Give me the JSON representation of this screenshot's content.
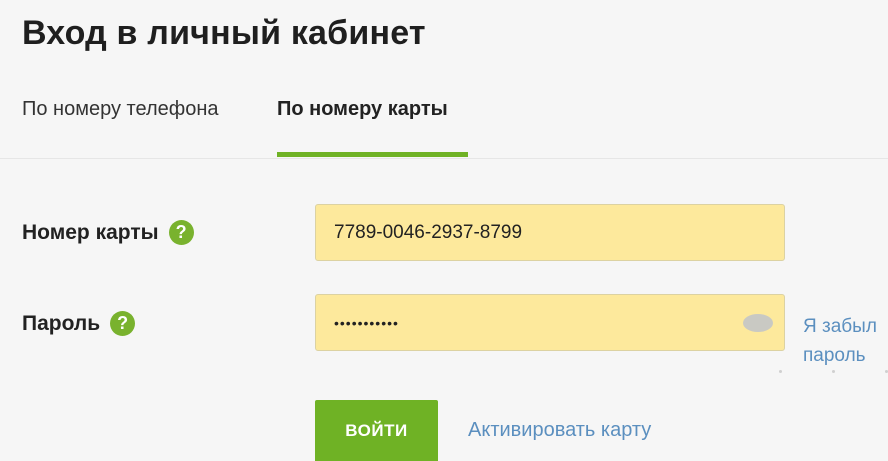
{
  "page": {
    "title": "Вход в личный кабинет"
  },
  "tabs": [
    {
      "label": "По номеру телефона",
      "active": false
    },
    {
      "label": "По номеру карты",
      "active": true
    }
  ],
  "form": {
    "card_label": "Номер карты",
    "card_value": "7789-0046-2937-8799",
    "password_label": "Пароль",
    "password_value": "•••••••••••",
    "help_glyph": "?",
    "forgot_link": "Я забыл пароль",
    "submit_label": "ВОЙТИ",
    "activate_link": "Активировать карту"
  },
  "icons": {
    "help": "question-circle-icon",
    "password_toggle": "eye-icon"
  },
  "colors": {
    "accent_green": "#6fb225",
    "help_green": "#79b22e",
    "input_background": "#fde99c",
    "link_blue": "#5b8fbf",
    "page_background": "#f6f6f6"
  }
}
